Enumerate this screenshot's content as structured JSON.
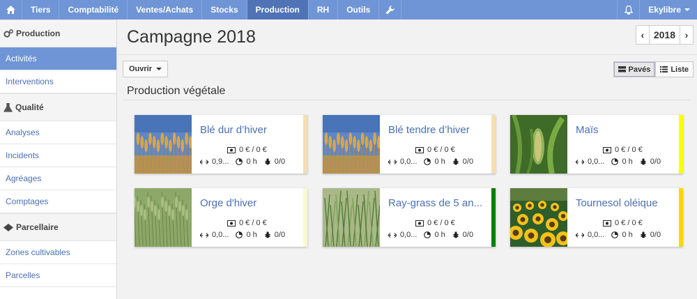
{
  "nav": {
    "items": [
      {
        "label": "Tiers"
      },
      {
        "label": "Comptabilité"
      },
      {
        "label": "Ventes/Achats"
      },
      {
        "label": "Stocks"
      },
      {
        "label": "Production",
        "active": true
      },
      {
        "label": "RH"
      },
      {
        "label": "Outils"
      }
    ],
    "user": "Ekylibre",
    "accent": "#6f95d6"
  },
  "sidebar": {
    "sections": [
      {
        "title": "Production",
        "icon": "gears-icon",
        "links": [
          "Activités",
          "Interventions"
        ]
      },
      {
        "title": "Qualité",
        "icon": "flask-icon",
        "links": [
          "Analyses",
          "Incidents",
          "Agréages",
          "Comptages"
        ]
      },
      {
        "title": "Parcellaire",
        "icon": "map-icon",
        "links": [
          "Zones cultivables",
          "Parcelles"
        ]
      }
    ],
    "active_link": "Activités"
  },
  "main": {
    "title": "Campagne 2018",
    "year": "2018",
    "open_button": "Ouvrir",
    "view_tiles": "Pavés",
    "view_list": "Liste",
    "section_title": "Production végétale"
  },
  "cards": [
    {
      "name": "Blé dur d’hiver",
      "money": "0 € / 0 €",
      "area": "0,9...",
      "time": "0 h",
      "issues": "0/0",
      "stripe": "#f5deb3",
      "thumb": "wheat"
    },
    {
      "name": "Blé tendre d’hiver",
      "money": "0 € / 0 €",
      "area": "0,0...",
      "time": "0 h",
      "issues": "0/0",
      "stripe": "#f5deb3",
      "thumb": "wheat"
    },
    {
      "name": "Maïs",
      "money": "0 € / 0 €",
      "area": "0,0...",
      "time": "0 h",
      "issues": "0/0",
      "stripe": "#ffff00",
      "thumb": "corn"
    },
    {
      "name": "Orge d'hiver",
      "money": "0 € / 0 €",
      "area": "0,0...",
      "time": "0 h",
      "issues": "0/0",
      "stripe": "#fafad2",
      "thumb": "barley"
    },
    {
      "name": "Ray-grass de 5 an...",
      "money": "0 € / 0 €",
      "area": "0,0...",
      "time": "0 h",
      "issues": "0/0",
      "stripe": "#008000",
      "thumb": "grass"
    },
    {
      "name": "Tournesol oléique",
      "money": "0 € / 0 €",
      "area": "0,0...",
      "time": "0 h",
      "issues": "0/0",
      "stripe": "#ffd700",
      "thumb": "sunflower"
    }
  ]
}
